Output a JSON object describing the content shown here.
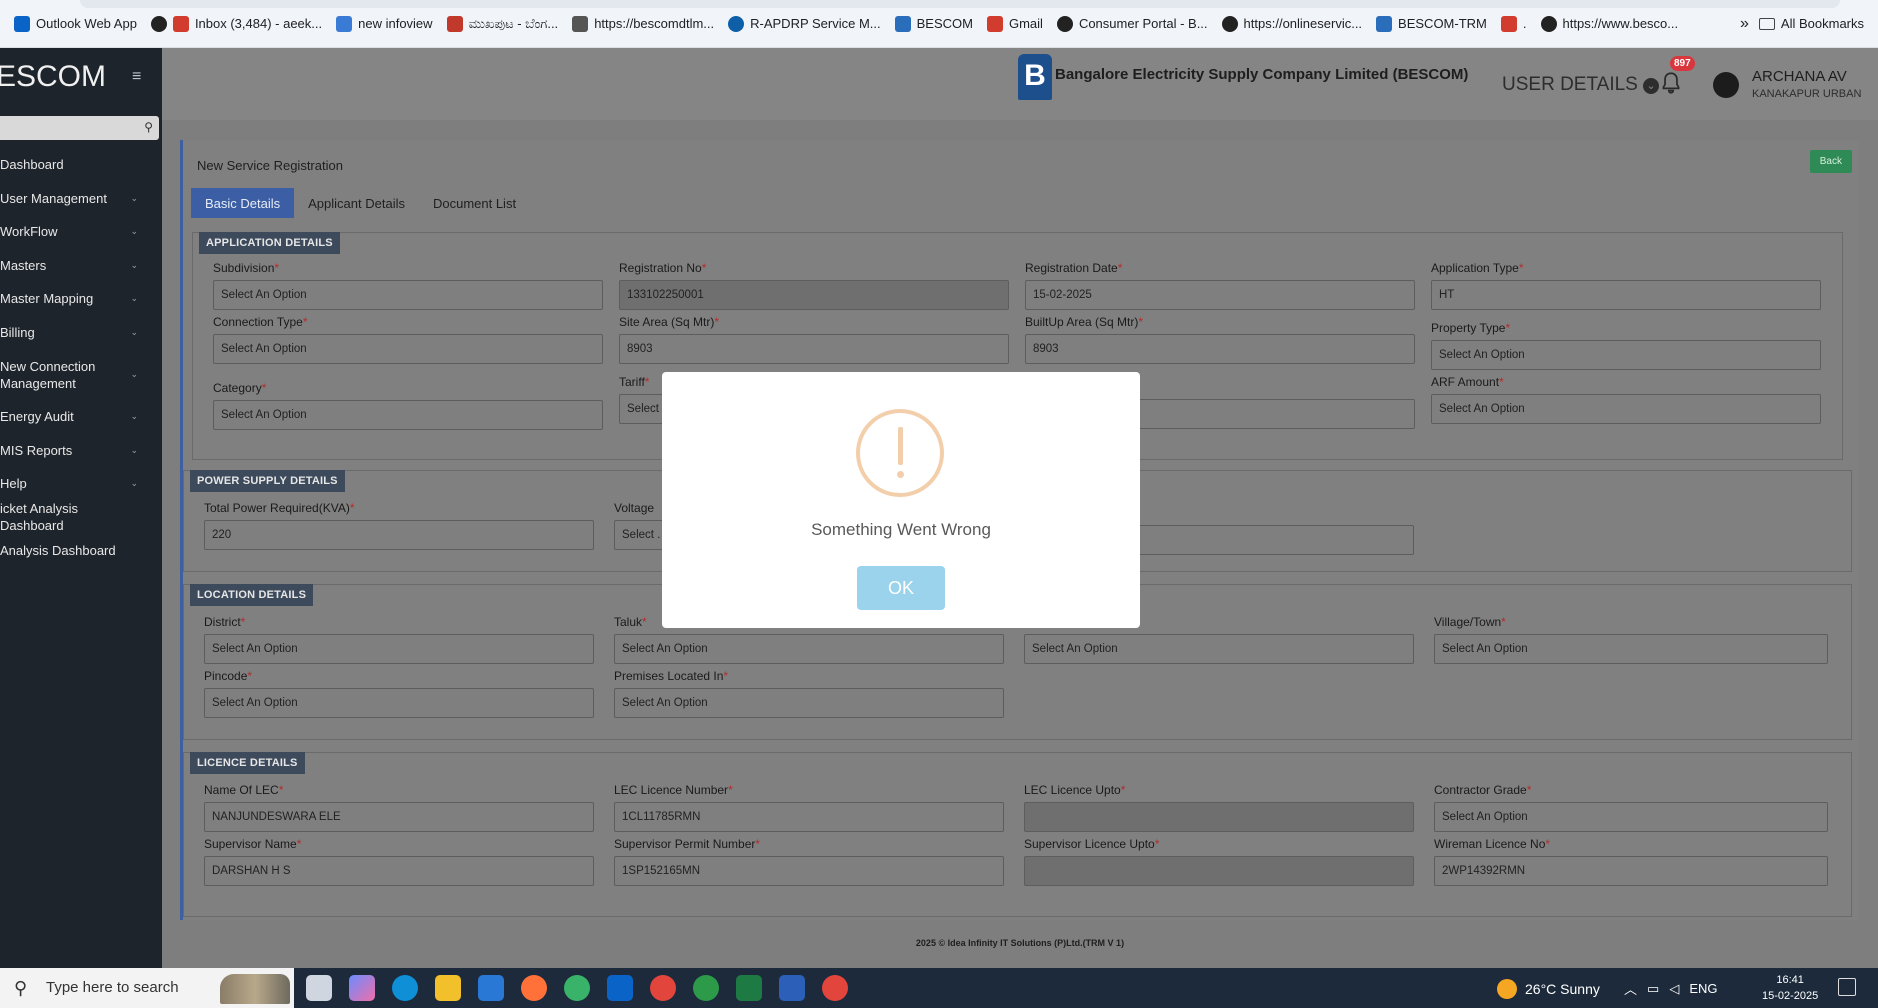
{
  "bookmarks": [
    "Outlook Web App",
    "Inbox (3,484) - aeek...",
    "new infoview",
    "ಮುಖಪುಟ - ಬೆಂಗ...",
    "https://bescomdtlm...",
    "R-APDRP Service M...",
    "BESCOM",
    "Gmail",
    "Consumer Portal - B...",
    "https://onlineservic...",
    "BESCOM-TRM",
    ".",
    "https://www.besco..."
  ],
  "bookmarks_more": "»",
  "all_bookmarks": "All Bookmarks",
  "sidebar": {
    "logo": "ESCOM",
    "items": [
      "Dashboard",
      "User Management",
      "WorkFlow",
      "Masters",
      "Master Mapping",
      "Billing",
      "New Connection Management",
      "Energy Audit",
      "MIS Reports",
      "Help",
      "icket Analysis Dashboard",
      "Analysis Dashboard"
    ]
  },
  "header": {
    "company": "Bangalore Electricity Supply Company Limited (BESCOM)",
    "logo_letter": "B",
    "user_details": "USER DETAILS",
    "notif_count": "897",
    "user_name": "ARCHANA AV",
    "user_location": "KANAKAPUR URBAN"
  },
  "page": {
    "title": "New Service Registration",
    "back": "Back",
    "tabs": [
      "Basic Details",
      "Applicant Details",
      "Document List"
    ]
  },
  "sections": {
    "application": "APPLICATION DETAILS",
    "power": "POWER SUPPLY DETAILS",
    "location": "LOCATION DETAILS",
    "licence": "LICENCE DETAILS"
  },
  "fields": {
    "subdivision": {
      "label": "Subdivision",
      "value": "Select An Option"
    },
    "regno": {
      "label": "Registration No",
      "value": "133102250001"
    },
    "regdate": {
      "label": "Registration Date",
      "value": "15-02-2025"
    },
    "apptype": {
      "label": "Application Type",
      "value": "HT"
    },
    "conntype": {
      "label": "Connection Type",
      "value": "Select An Option"
    },
    "sitearea": {
      "label": "Site Area (Sq Mtr)",
      "value": "8903"
    },
    "builtup": {
      "label": "BuiltUp Area (Sq Mtr)",
      "value": "8903"
    },
    "proptype": {
      "label": "Property Type",
      "value": "Select An Option"
    },
    "category": {
      "label": "Category",
      "value": "Select An Option"
    },
    "tariff": {
      "label": "Tariff",
      "value": "Select"
    },
    "arf": {
      "label": "ARF Amount",
      "value": "Select An Option"
    },
    "totalpower": {
      "label": "Total Power Required(KVA)",
      "value": "220"
    },
    "voltage": {
      "label": "Voltage",
      "value": "Select ."
    },
    "district": {
      "label": "District",
      "value": "Select An Option"
    },
    "taluk": {
      "label": "Taluk",
      "value": "Select An Option"
    },
    "loc3": {
      "value": "Select An Option"
    },
    "village": {
      "label": "Village/Town",
      "value": "Select An Option"
    },
    "pincode": {
      "label": "Pincode",
      "value": "Select An Option"
    },
    "premises": {
      "label": "Premises Located In",
      "value": "Select An Option"
    },
    "lec": {
      "label": "Name Of LEC",
      "value": "NANJUNDESWARA ELE"
    },
    "lecno": {
      "label": "LEC Licence Number",
      "value": "1CL11785RMN"
    },
    "lecupto": {
      "label": "LEC Licence Upto",
      "value": ""
    },
    "grade": {
      "label": "Contractor Grade",
      "value": "Select An Option"
    },
    "supname": {
      "label": "Supervisor Name",
      "value": "DARSHAN H S"
    },
    "supno": {
      "label": "Supervisor Permit Number",
      "value": "1SP152165MN"
    },
    "supupto": {
      "label": "Supervisor Licence Upto",
      "value": ""
    },
    "wireman": {
      "label": "Wireman Licence No",
      "value": "2WP14392RMN"
    }
  },
  "footer": "2025 © Idea Infinity IT Solutions (P)Ltd.(TRM V 1)",
  "modal": {
    "message": "Something Went Wrong",
    "ok": "OK",
    "icon": "!"
  },
  "taskbar": {
    "search_placeholder": "Type here to search",
    "weather": "26°C  Sunny",
    "lang": "ENG",
    "time": "16:41",
    "date": "15-02-2025"
  }
}
